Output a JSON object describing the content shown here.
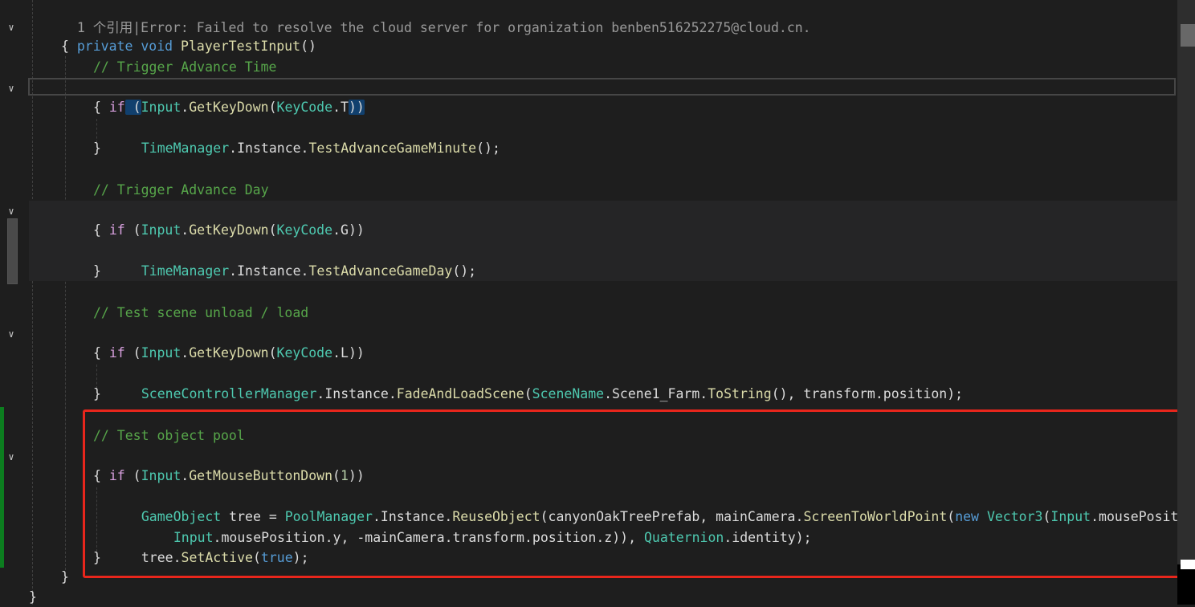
{
  "codelens": "1 个引用|Error: Failed to resolve the cloud server for organization benben516252275@cloud.cn.",
  "method_decl": {
    "kw1": "private",
    "kw2": "void",
    "name": "PlayerTestInput",
    "tail": "()"
  },
  "brace_open": "{",
  "brace_close": "}",
  "block1": {
    "comment": "// Trigger Advance Time",
    "if": "if",
    "cond_a": " (",
    "input": "Input",
    "dot": ".",
    "method": "GetKeyDown",
    "paren": "(",
    "keycode": "KeyCode",
    "key": ".T",
    "cond_b": "))",
    "body_type": "TimeManager",
    "body_mid": ".Instance.",
    "body_fn": "TestAdvanceGameMinute",
    "body_tail": "();"
  },
  "block2": {
    "comment": "// Trigger Advance Day",
    "if": "if",
    "cond_a": " (",
    "input": "Input",
    "dot": ".",
    "method": "GetKeyDown",
    "paren": "(",
    "keycode": "KeyCode",
    "key": ".G",
    "cond_b": "))",
    "body_type": "TimeManager",
    "body_mid": ".Instance.",
    "body_fn": "TestAdvanceGameDay",
    "body_tail": "();"
  },
  "block3": {
    "comment": "// Test scene unload / load",
    "if": "if",
    "cond_a": " (",
    "input": "Input",
    "dot": ".",
    "method": "GetKeyDown",
    "paren": "(",
    "keycode": "KeyCode",
    "key": ".L",
    "cond_b": "))",
    "body_type": "SceneControllerManager",
    "body_mid": ".Instance.",
    "body_fn": "FadeAndLoadScene",
    "body_p1": "(",
    "body_type2": "SceneName",
    "body_mid2": ".Scene1_Farm.",
    "body_fn2": "ToString",
    "body_tail": "(), transform.position);"
  },
  "block4": {
    "comment": "// Test object pool",
    "if": "if",
    "cond_a": " (",
    "input": "Input",
    "dot": ".",
    "method": "GetMouseButtonDown",
    "paren": "(",
    "num": "1",
    "cond_b": "))",
    "l1_type": "GameObject",
    "l1_a": " tree = ",
    "l1_type2": "PoolManager",
    "l1_b": ".Instance.",
    "l1_fn": "ReuseObject",
    "l1_c": "(canyonOakTreePrefab, mainCamera.",
    "l1_fn2": "ScreenToWorldPoint",
    "l1_d": "(",
    "l1_new": "new",
    "l1_sp": " ",
    "l1_type3": "Vector3",
    "l1_e": "(",
    "l1_type4": "Input",
    "l1_f": ".mousePositi",
    "l2_type": "Input",
    "l2_a": ".mousePosition.y, -mainCamera.transform.position.z)), ",
    "l2_type2": "Quaternion",
    "l2_b": ".identity);",
    "l3_a": "tree.",
    "l3_fn": "SetActive",
    "l3_b": "(",
    "l3_kw": "true",
    "l3_c": ");"
  }
}
